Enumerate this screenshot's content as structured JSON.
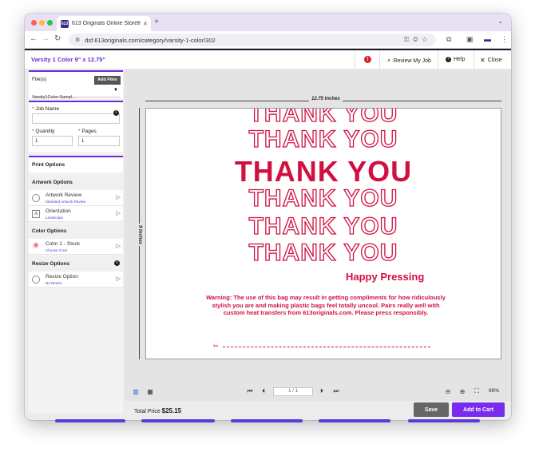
{
  "browser": {
    "tab_title": "613 Originals Online Storefro",
    "tab_favicon_text": "613",
    "url": "dsf.613originals.com/category/varsity-1-color/302"
  },
  "header": {
    "title": "Varsity 1 Color 9\" x 12.75\"",
    "alert_count": "!",
    "review_label": "Review My Job",
    "help_label": "Help",
    "close_label": "Close"
  },
  "files": {
    "label": "File(s)",
    "add_button": "Add Files",
    "selected_file": "Varsity1Color-Sampl..."
  },
  "job": {
    "name_label": "Job Name",
    "name_value": "",
    "quantity_label": "Quantity",
    "quantity_value": "1",
    "pages_label": "Pages",
    "pages_value": "1"
  },
  "print_options_label": "Print Options",
  "artwork_options": {
    "header": "Artwork Options",
    "review_title": "Artwork Review",
    "review_sub": "Standard Artwork Review",
    "orientation_title": "Orientation",
    "orientation_sub": "Landscape"
  },
  "color_options": {
    "header": "Color Options",
    "color_title": "Color 1 - Stock",
    "color_sub": "Choose Color"
  },
  "resize_options": {
    "header": "Resize Options",
    "resize_title": "Resize Option",
    "resize_sub": "No Resize"
  },
  "canvas": {
    "width_label": "12.75 Inches",
    "height_label": "9 Inches",
    "art_line": "THANK YOU",
    "happy": "Happy Pressing",
    "warning_bold": "Warning:",
    "warning_text": " The use of this bag may result in getting compliments for how ridiculously stylish you are and making plastic bags feel totally uncool. Pairs really well with custom heat transfers from 613originals.com. Please press responsibly."
  },
  "toolbar": {
    "page_indicator": "1 / 1",
    "zoom": "99%"
  },
  "footer": {
    "total_label": "Total Price",
    "total_value": "$25.15",
    "save_label": "Save",
    "cart_label": "Add to Cart"
  },
  "colors": {
    "accent": "#6a2cd8",
    "cart": "#7a2bf0",
    "art": "#d01040"
  }
}
